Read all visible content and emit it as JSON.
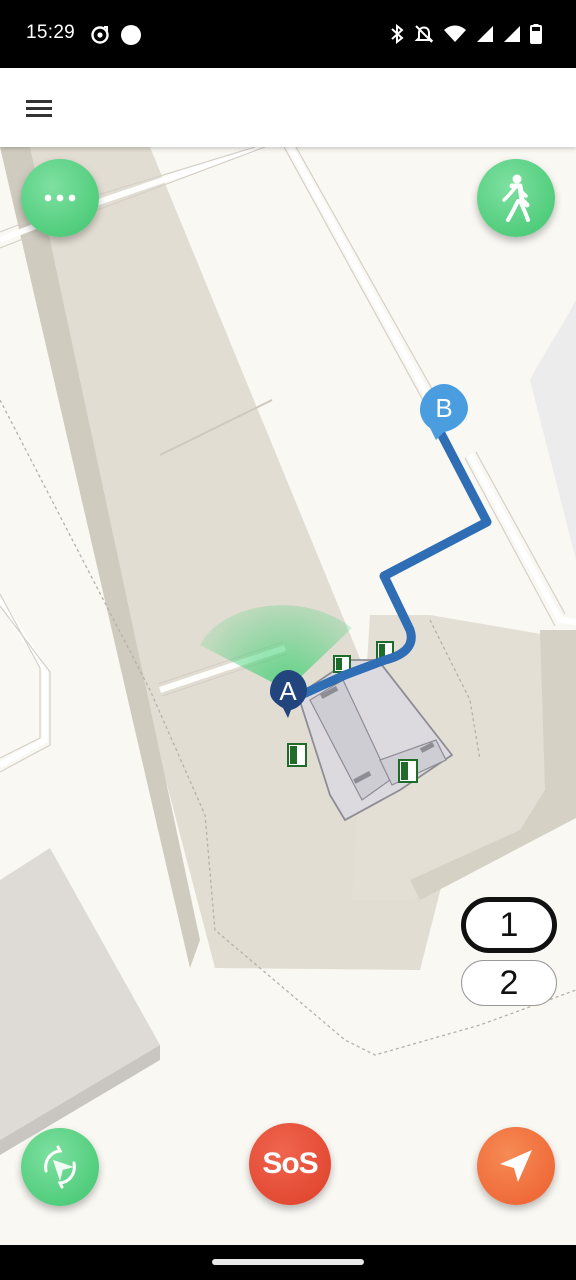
{
  "status_bar": {
    "time": "15:29",
    "left_icons": [
      "music-sync-icon",
      "dot-icon"
    ],
    "right_icons": [
      "bluetooth-icon",
      "mute-icon",
      "wifi-icon",
      "signal-icon",
      "signal-icon",
      "battery-icon"
    ]
  },
  "app_bar": {
    "menu_icon": "hamburger-menu-icon"
  },
  "map": {
    "start_marker": "A",
    "end_marker": "B",
    "route_color": "#2f6db5",
    "start_marker_color": "#23457d",
    "end_marker_color": "#4a9ee0"
  },
  "buttons": {
    "more": "more-options-icon",
    "walk_mode": "walking-person-icon",
    "recenter": "compass-rotate-icon",
    "sos_label": "SoS",
    "navigate": "navigation-arrow-icon"
  },
  "floors": {
    "active": "1",
    "other": "2"
  },
  "colors": {
    "green_button": "#4cc97a",
    "sos_red": "#e24a33",
    "navigate_orange": "#ef6a35",
    "map_background": "#faf8f3"
  }
}
